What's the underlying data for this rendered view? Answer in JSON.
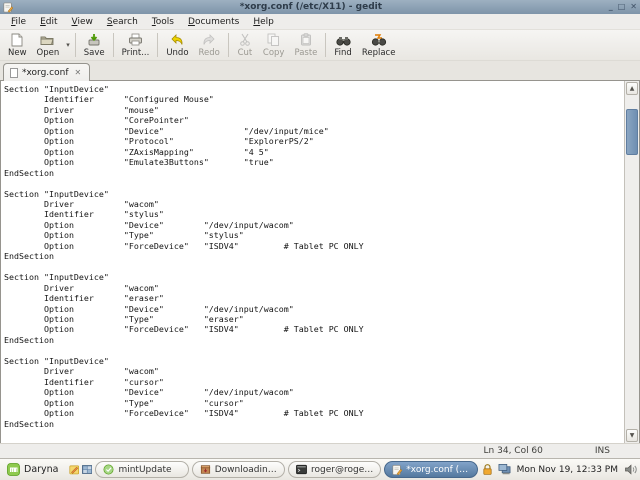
{
  "window": {
    "title": "*xorg.conf (/etc/X11) - gedit",
    "controls": {
      "minimize": "_",
      "maximize": "□",
      "close": "✕"
    },
    "app_icon": "gedit-notepad-pencil-icon"
  },
  "menu_bar": {
    "items": [
      "File",
      "Edit",
      "View",
      "Search",
      "Tools",
      "Documents",
      "Help"
    ]
  },
  "toolbar": {
    "buttons": [
      {
        "label": "New",
        "icon": "new-document-icon",
        "enabled": true
      },
      {
        "label": "Open",
        "icon": "open-folder-icon",
        "enabled": true
      },
      {
        "label": "Save",
        "icon": "save-icon",
        "enabled": true
      },
      {
        "label": "Print...",
        "icon": "printer-icon",
        "enabled": true
      },
      {
        "label": "Undo",
        "icon": "undo-arrow-icon",
        "enabled": true
      },
      {
        "label": "Redo",
        "icon": "redo-arrow-icon",
        "enabled": false
      },
      {
        "label": "Cut",
        "icon": "scissors-icon",
        "enabled": false
      },
      {
        "label": "Copy",
        "icon": "copy-pages-icon",
        "enabled": false
      },
      {
        "label": "Paste",
        "icon": "clipboard-icon",
        "enabled": false
      },
      {
        "label": "Find",
        "icon": "binoculars-icon",
        "enabled": true
      },
      {
        "label": "Replace",
        "icon": "binoculars-replace-icon",
        "enabled": true
      }
    ],
    "open_dropdown_glyph": "▾"
  },
  "tab": {
    "title": "*xorg.conf",
    "close_glyph": "✕"
  },
  "editor": {
    "content": "Section \"InputDevice\"\n\tIdentifier\t\"Configured Mouse\"\n\tDriver\t\t\"mouse\"\n\tOption\t\t\"CorePointer\"\n\tOption\t\t\"Device\"\t\t\"/dev/input/mice\"\n\tOption\t\t\"Protocol\"\t\t\"ExplorerPS/2\"\n\tOption\t\t\"ZAxisMapping\"\t\t\"4 5\"\n\tOption\t\t\"Emulate3Buttons\"\t\"true\"\nEndSection\n\nSection \"InputDevice\"\n\tDriver\t\t\"wacom\"\n\tIdentifier\t\"stylus\"\n\tOption\t\t\"Device\"\t\"/dev/input/wacom\"\n\tOption\t\t\"Type\"\t\t\"stylus\"\n\tOption\t\t\"ForceDevice\"\t\"ISDV4\"\t\t# Tablet PC ONLY\nEndSection\n\nSection \"InputDevice\"\n\tDriver\t\t\"wacom\"\n\tIdentifier\t\"eraser\"\n\tOption\t\t\"Device\"\t\"/dev/input/wacom\"\n\tOption\t\t\"Type\"\t\t\"eraser\"\n\tOption\t\t\"ForceDevice\"\t\"ISDV4\"\t\t# Tablet PC ONLY\nEndSection\n\nSection \"InputDevice\"\n\tDriver\t\t\"wacom\"\n\tIdentifier\t\"cursor\"\n\tOption\t\t\"Device\"\t\"/dev/input/wacom\"\n\tOption\t\t\"Type\"\t\t\"cursor\"\n\tOption\t\t\"ForceDevice\"\t\"ISDV4\"\t\t# Tablet PC ONLY\nEndSection"
  },
  "scrollbar": {
    "up_glyph": "▲",
    "down_glyph": "▼"
  },
  "status_bar": {
    "position": "Ln 34, Col 60",
    "mode": "INS"
  },
  "taskbar": {
    "menu_label": "Daryna",
    "menu_icon": "linuxmint-logo-icon",
    "quick_icons": [
      "notes-pencil-icon",
      "workspace-pager-icon"
    ],
    "tasks": [
      {
        "label": "mintUpdate",
        "icon": "mintupdate-shield-icon",
        "active": false
      },
      {
        "label": "Downloading pac...",
        "icon": "package-download-icon",
        "active": false
      },
      {
        "label": "roger@roger-des...",
        "icon": "terminal-icon",
        "active": false
      },
      {
        "label": "*xorg.conf (/etc/...",
        "icon": "gedit-notepad-pencil-icon",
        "active": true
      }
    ],
    "tray_icons": [
      "padlock-icon",
      "network-monitors-icon",
      "speaker-icon"
    ],
    "clock": "Mon Nov 19, 12:33 PM"
  },
  "colors": {
    "titlebar": "#8399ae",
    "panel_bg": "#eeedeb",
    "active_task": "#5a7ea6",
    "scroll_thumb": "#7b97b8",
    "editor_bg": "#ffffff",
    "editor_text": "#141414"
  }
}
